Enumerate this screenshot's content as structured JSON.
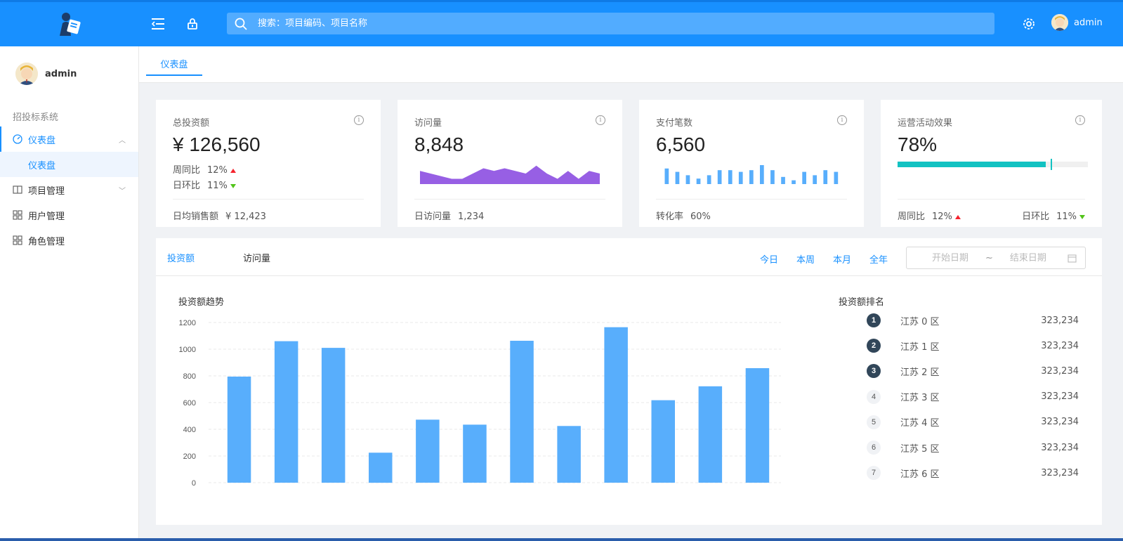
{
  "header": {
    "search_placeholder": "搜索：项目编码、项目名称",
    "user_name": "admin"
  },
  "sidebar": {
    "user_name": "admin",
    "group_title": "招投标系统",
    "items": [
      {
        "label": "仪表盘",
        "expanded": true
      },
      {
        "label": "仪表盘"
      },
      {
        "label": "项目管理"
      },
      {
        "label": "用户管理"
      },
      {
        "label": "角色管理"
      }
    ]
  },
  "tabs": {
    "active": "仪表盘"
  },
  "cards": [
    {
      "label": "总投资额",
      "value": "¥ 126,560",
      "wow_label": "周同比",
      "wow": "12%",
      "dod_label": "日环比",
      "dod": "11%",
      "foot_label": "日均销售额",
      "foot_value": "¥ 12,423"
    },
    {
      "label": "访问量",
      "value": "8,848",
      "foot_label": "日访问量",
      "foot_value": "1,234"
    },
    {
      "label": "支付笔数",
      "value": "6,560",
      "foot_label": "转化率",
      "foot_value": "60%"
    },
    {
      "label": "运营活动效果",
      "value": "78%",
      "progress": 0.78,
      "target": 0.805,
      "wow_label": "周同比",
      "wow": "12%",
      "dod_label": "日环比",
      "dod": "11%"
    }
  ],
  "visits_area": [
    5,
    4,
    3,
    2,
    2,
    4,
    6,
    5,
    6,
    5,
    4,
    7,
    4,
    2,
    5,
    2,
    5,
    4
  ],
  "pay_bars": [
    8,
    6,
    4,
    2,
    4,
    7,
    7,
    6,
    7,
    10,
    7,
    3,
    1,
    6,
    4,
    7,
    6
  ],
  "panel": {
    "tabs": [
      "投资额",
      "访问量"
    ],
    "periods": [
      "今日",
      "本周",
      "本月",
      "全年"
    ],
    "date_start_placeholder": "开始日期",
    "date_sep": "~",
    "date_end_placeholder": "结束日期",
    "chart_title": "投资额趋势",
    "rank_title": "投资额排名",
    "ranking": [
      {
        "rank": "1",
        "name": "江苏 0 区",
        "value": "323,234"
      },
      {
        "rank": "2",
        "name": "江苏 1 区",
        "value": "323,234"
      },
      {
        "rank": "3",
        "name": "江苏 2 区",
        "value": "323,234"
      },
      {
        "rank": "4",
        "name": "江苏 3 区",
        "value": "323,234"
      },
      {
        "rank": "5",
        "name": "江苏 4 区",
        "value": "323,234"
      },
      {
        "rank": "6",
        "name": "江苏 5 区",
        "value": "323,234"
      },
      {
        "rank": "7",
        "name": "江苏 6 区",
        "value": "323,234"
      }
    ]
  },
  "chart_data": {
    "type": "bar",
    "values": [
      795,
      1060,
      1010,
      225,
      472,
      435,
      1063,
      425,
      1165,
      618,
      722,
      858
    ],
    "ylim": [
      0,
      1200
    ],
    "yticks": [
      "0",
      "200",
      "400",
      "600",
      "800",
      "1000",
      "1200"
    ],
    "color": "#58aefc",
    "grid": true
  },
  "colors": {
    "primary": "#1890ff",
    "area": "#975fe4",
    "bar": "#58aefc",
    "progress": "#13c2c2"
  }
}
